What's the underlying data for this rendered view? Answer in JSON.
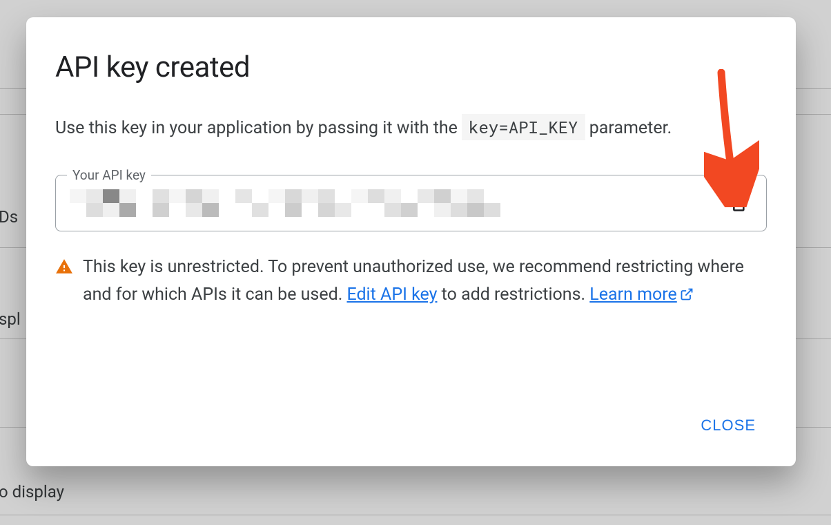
{
  "dialog": {
    "title": "API key created",
    "description_pre": "Use this key in your application by passing it with the ",
    "code_param": "key=API_KEY",
    "description_post": " parameter.",
    "field_label": "Your API key",
    "api_key_value": "[redacted]",
    "warning_text_1": "This key is unrestricted. To prevent unauthorized use, we recommend restricting where and for which APIs it can be used. ",
    "edit_link": "Edit API key",
    "warning_text_2": " to add restrictions. ",
    "learn_more": "Learn more",
    "close_label": "CLOSE"
  },
  "background": {
    "text_1": "Ds",
    "text_2": "spl",
    "text_3": "o display"
  },
  "colors": {
    "link": "#1a73e8",
    "warning": "#e8710a",
    "arrow": "#f24822"
  }
}
